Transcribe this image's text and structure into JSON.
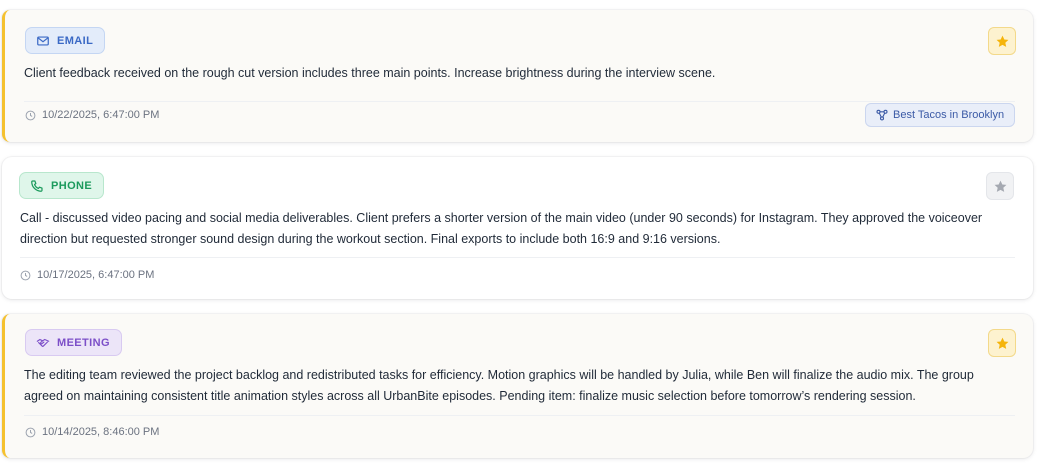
{
  "colors": {
    "starred_accent": "#f5c12e",
    "email": "#3a69c5",
    "phone": "#1b9a5c",
    "meeting": "#7c4fc8",
    "project_link": "#3b5aa6"
  },
  "entries": [
    {
      "type": "EMAIL",
      "icon": "mail-icon",
      "starred": true,
      "text": "Client feedback received on the rough cut version includes three main points. Increase brightness during the interview scene.",
      "timestamp": "10/22/2025, 6:47:00 PM",
      "project": "Best Tacos in Brooklyn",
      "project_icon": "workflow-icon"
    },
    {
      "type": "PHONE",
      "icon": "phone-icon",
      "starred": false,
      "text": "Call - discussed video pacing and social media deliverables. Client prefers a shorter version of the main video (under 90 seconds) for Instagram. They approved the voiceover direction but requested stronger sound design during the workout section. Final exports to include both 16:9 and 9:16 versions.",
      "timestamp": "10/17/2025, 6:47:00 PM"
    },
    {
      "type": "MEETING",
      "icon": "handshake-icon",
      "starred": true,
      "text": "The editing team reviewed the project backlog and redistributed tasks for efficiency. Motion graphics will be handled by Julia, while Ben will finalize the audio mix. The group agreed on maintaining consistent title animation styles across all UrbanBite episodes. Pending item: finalize music selection before tomorrow’s rendering session.",
      "timestamp": "10/14/2025, 8:46:00 PM"
    }
  ]
}
